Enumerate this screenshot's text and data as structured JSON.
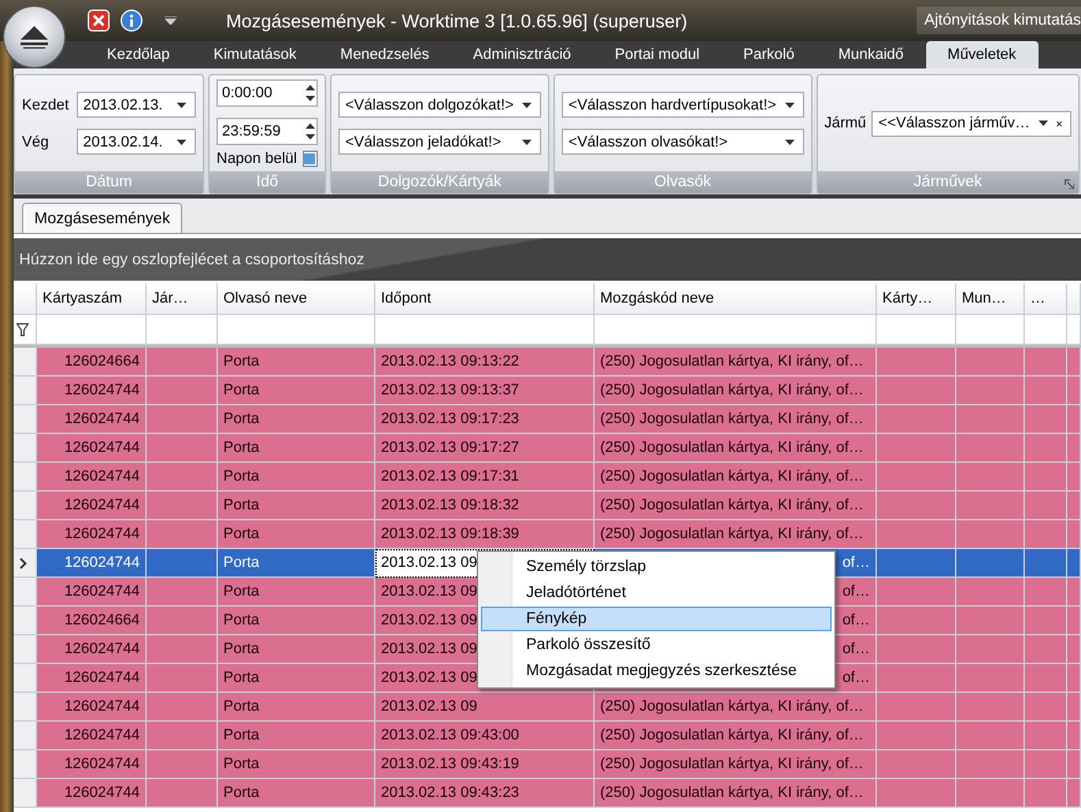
{
  "title_bar": {
    "title": "Mozgásesemények - Worktime 3 [1.0.65.96] (superuser)",
    "right_text": "Ajtónyitások kimutatás"
  },
  "ribbon": {
    "tabs": [
      {
        "label": "Kezdőlap",
        "selected": false
      },
      {
        "label": "Kimutatások",
        "selected": false
      },
      {
        "label": "Menedzselés",
        "selected": false
      },
      {
        "label": "Adminisztráció",
        "selected": false
      },
      {
        "label": "Portai modul",
        "selected": false
      },
      {
        "label": "Parkoló",
        "selected": false
      },
      {
        "label": "Munkaidő",
        "selected": false
      },
      {
        "label": "Műveletek",
        "selected": true
      }
    ],
    "groups": [
      {
        "kind": "date",
        "label": "Dátum",
        "fields": [
          {
            "label": "Kezdet",
            "value": "2013.02.13."
          },
          {
            "label": "Vég",
            "value": "2013.02.14."
          }
        ]
      },
      {
        "kind": "time",
        "label": "Idő",
        "spins": [
          "0:00:00",
          "23:59:59"
        ],
        "checkbox": {
          "label": "Napon belül",
          "checked": true
        }
      },
      {
        "kind": "combos",
        "label": "Dolgozók/Kártyák",
        "combos": [
          "<Válasszon dolgozókat!>",
          "<Válasszon jeladókat!>"
        ]
      },
      {
        "kind": "combos",
        "label": "Olvasók",
        "combos": [
          "<Válasszon hardvertípusokat!>",
          "<Válasszon olvasókat!>"
        ]
      },
      {
        "kind": "vehicle",
        "label": "Járművek",
        "field_label": "Jármű",
        "value": "<<Válasszon járműv…"
      }
    ]
  },
  "document_tabs": [
    {
      "label": "Mozgásesemények",
      "selected": true
    }
  ],
  "grid": {
    "group_hint": "Húzzon ide egy oszlopfejlécet a csoportosításhoz",
    "columns": [
      "Kártyaszám",
      "Jár…",
      "Olvasó neve",
      "Időpont",
      "Mozgáskód neve",
      "Kárty…",
      "Mun…",
      "…"
    ],
    "rows": [
      {
        "selected": false,
        "covered": false,
        "card": "126024664",
        "reader": "Porta",
        "time": "2013.02.13 09:13:22",
        "code": "(250) Jogosulatlan kártya, KI irány, of…"
      },
      {
        "selected": false,
        "covered": false,
        "card": "126024744",
        "reader": "Porta",
        "time": "2013.02.13 09:13:37",
        "code": "(250) Jogosulatlan kártya, KI irány, of…"
      },
      {
        "selected": false,
        "covered": false,
        "card": "126024744",
        "reader": "Porta",
        "time": "2013.02.13 09:17:23",
        "code": "(250) Jogosulatlan kártya, KI irány, of…"
      },
      {
        "selected": false,
        "covered": false,
        "card": "126024744",
        "reader": "Porta",
        "time": "2013.02.13 09:17:27",
        "code": "(250) Jogosulatlan kártya, KI irány, of…"
      },
      {
        "selected": false,
        "covered": false,
        "card": "126024744",
        "reader": "Porta",
        "time": "2013.02.13 09:17:31",
        "code": "(250) Jogosulatlan kártya, KI irány, of…"
      },
      {
        "selected": false,
        "covered": false,
        "card": "126024744",
        "reader": "Porta",
        "time": "2013.02.13 09:18:32",
        "code": "(250) Jogosulatlan kártya, KI irány, of…"
      },
      {
        "selected": false,
        "covered": false,
        "card": "126024744",
        "reader": "Porta",
        "time": "2013.02.13 09:18:39",
        "code": "(250) Jogosulatlan kártya, KI irány, of…"
      },
      {
        "selected": true,
        "covered": true,
        "card": "126024744",
        "reader": "Porta",
        "time": "2013.02.13 09",
        "code": "of…"
      },
      {
        "selected": false,
        "covered": true,
        "card": "126024744",
        "reader": "Porta",
        "time": "2013.02.13 09",
        "code": "of…"
      },
      {
        "selected": false,
        "covered": true,
        "card": "126024664",
        "reader": "Porta",
        "time": "2013.02.13 09",
        "code": "of…"
      },
      {
        "selected": false,
        "covered": true,
        "card": "126024744",
        "reader": "Porta",
        "time": "2013.02.13 09",
        "code": "of…"
      },
      {
        "selected": false,
        "covered": true,
        "card": "126024744",
        "reader": "Porta",
        "time": "2013.02.13 09",
        "code": "of…"
      },
      {
        "selected": false,
        "covered": false,
        "card": "126024744",
        "reader": "Porta",
        "time": "2013.02.13 09",
        "code": "(250) Jogosulatlan kártya, KI irány, of…"
      },
      {
        "selected": false,
        "covered": false,
        "card": "126024744",
        "reader": "Porta",
        "time": "2013.02.13 09:43:00",
        "code": "(250) Jogosulatlan kártya, KI irány, of…"
      },
      {
        "selected": false,
        "covered": false,
        "card": "126024744",
        "reader": "Porta",
        "time": "2013.02.13 09:43:19",
        "code": "(250) Jogosulatlan kártya, KI irány, of…"
      },
      {
        "selected": false,
        "covered": false,
        "card": "126024744",
        "reader": "Porta",
        "time": "2013.02.13 09:43:23",
        "code": "(250) Jogosulatlan kártya, KI irány, of…"
      }
    ]
  },
  "context_menu": {
    "items": [
      {
        "label": "Személy törzslap",
        "selected": false
      },
      {
        "label": "Jeladótörténet",
        "selected": false
      },
      {
        "label": "Fénykép",
        "selected": true
      },
      {
        "label": "Parkoló összesítő",
        "selected": false
      },
      {
        "label": "Mozgásadat megjegyzés szerkesztése",
        "selected": false
      }
    ]
  }
}
